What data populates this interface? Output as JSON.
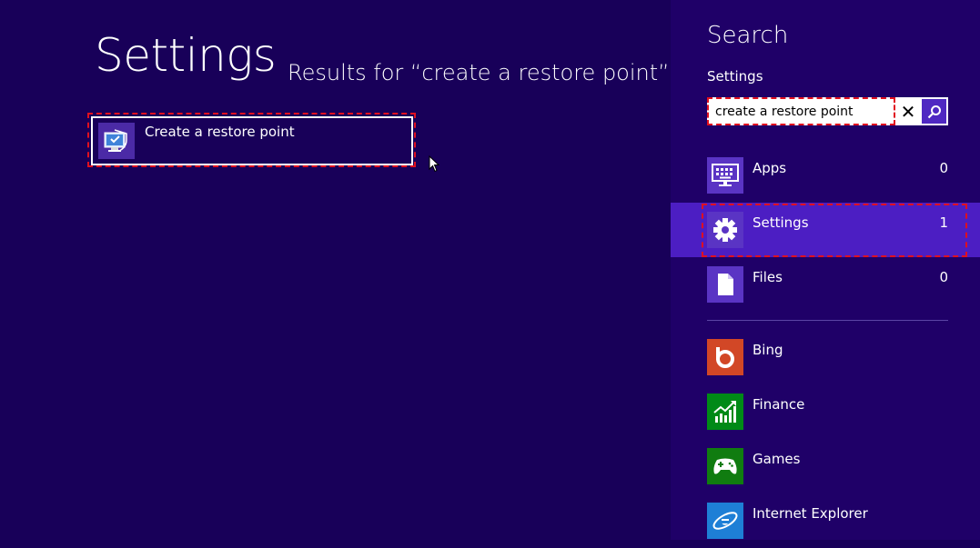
{
  "main": {
    "title": "Settings",
    "results_for": "Results for “create a restore point”",
    "results": [
      {
        "label": "Create a restore point",
        "icon": "system-protection-icon"
      }
    ]
  },
  "pane": {
    "title": "Search",
    "scope_label": "Settings",
    "search": {
      "value": "create a restore point",
      "clear_icon": "close-icon",
      "submit_icon": "search-icon"
    },
    "scopes": [
      {
        "label": "Apps",
        "count": "0",
        "icon": "keyboard-monitor-icon",
        "color": "#5a34c4"
      },
      {
        "label": "Settings",
        "count": "1",
        "icon": "gear-icon",
        "color": "#5a34c4",
        "selected": true
      },
      {
        "label": "Files",
        "count": "0",
        "icon": "document-icon",
        "color": "#5a34c4"
      }
    ],
    "apps": [
      {
        "label": "Bing",
        "icon": "bing-icon",
        "color": "#d24726"
      },
      {
        "label": "Finance",
        "icon": "finance-chart-icon",
        "color": "#008a17"
      },
      {
        "label": "Games",
        "icon": "gamepad-icon",
        "color": "#107c10"
      },
      {
        "label": "Internet Explorer",
        "icon": "internet-explorer-icon",
        "color": "#1e7fd6"
      }
    ]
  },
  "colors": {
    "background": "#180059",
    "pane_background": "#1f0068",
    "selected_row": "#4c1ec3",
    "annotation": "#e0101f"
  }
}
